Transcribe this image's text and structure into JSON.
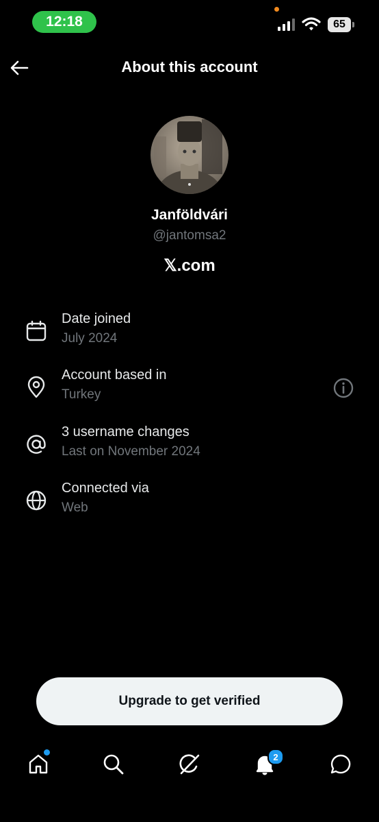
{
  "status_bar": {
    "time": "12:18",
    "battery": "65",
    "colors": {
      "time_pill": "#2fc24b",
      "privacy_dot": "#f28b1f"
    },
    "icons": [
      "signal-icon",
      "wifi-icon",
      "battery-icon"
    ]
  },
  "header": {
    "title": "About this account",
    "back_icon": "arrow-left-icon"
  },
  "profile": {
    "display_name": "Janföldvári",
    "handle": "@jantomsa2",
    "site": "𝕏.com"
  },
  "details": [
    {
      "icon": "calendar-icon",
      "label": "Date joined",
      "value": "July 2024"
    },
    {
      "icon": "location-pin-icon",
      "label": "Account based in",
      "value": "Turkey",
      "action_icon": "info-icon"
    },
    {
      "icon": "at-sign-icon",
      "label": "3 username changes",
      "value": "Last on November 2024"
    },
    {
      "icon": "globe-icon",
      "label": "Connected via",
      "value": "Web"
    }
  ],
  "cta": {
    "label": "Upgrade to get verified"
  },
  "tab_bar": {
    "tabs": [
      {
        "name": "home",
        "icon": "home-icon",
        "badge_dot": true
      },
      {
        "name": "search",
        "icon": "search-icon"
      },
      {
        "name": "grok",
        "icon": "grok-icon"
      },
      {
        "name": "notifications",
        "icon": "bell-icon",
        "badge_count": "2"
      },
      {
        "name": "messages",
        "icon": "chat-bubble-icon"
      }
    ],
    "accent": "#1d9bf0"
  }
}
